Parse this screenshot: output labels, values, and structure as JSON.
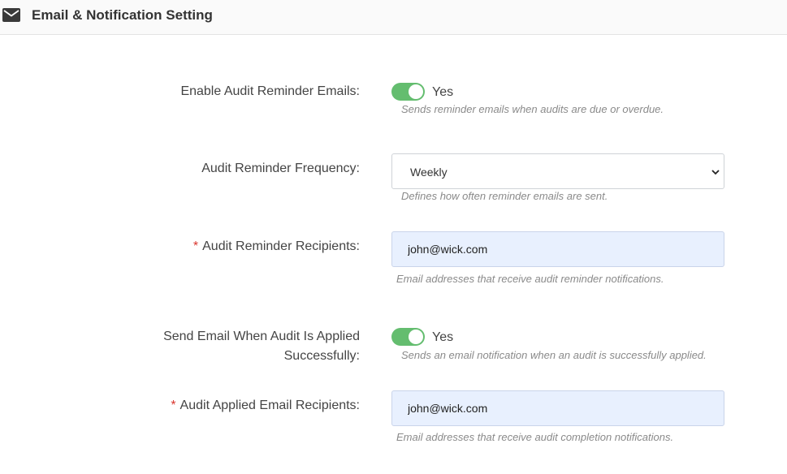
{
  "header": {
    "icon": "envelope-icon",
    "title": "Email & Notification Setting"
  },
  "fields": {
    "enable_audit_reminder": {
      "label": "Enable Audit Reminder Emails:",
      "toggle_on": true,
      "toggle_text": "Yes",
      "help": "Sends reminder emails when audits are due or overdue."
    },
    "reminder_frequency": {
      "label": "Audit Reminder Frequency:",
      "selected": "Weekly",
      "help": "Defines how often reminder emails are sent."
    },
    "reminder_recipients": {
      "required_mark": "*",
      "label": "Audit Reminder Recipients:",
      "value": "john@wick.com",
      "help": "Email addresses that receive audit reminder notifications."
    },
    "send_email_applied": {
      "label_line1": "Send Email When Audit Is Applied",
      "label_line2": "Successfully:",
      "toggle_on": true,
      "toggle_text": "Yes",
      "help": "Sends an email notification when an audit is successfully applied."
    },
    "applied_recipients": {
      "required_mark": "*",
      "label": "Audit Applied Email Recipients:",
      "value": "john@wick.com",
      "help": "Email addresses that receive audit completion notifications."
    }
  },
  "colors": {
    "toggle_on": "#64bd6f",
    "required": "#d9362f",
    "autofill_bg": "#e8f0fe"
  }
}
